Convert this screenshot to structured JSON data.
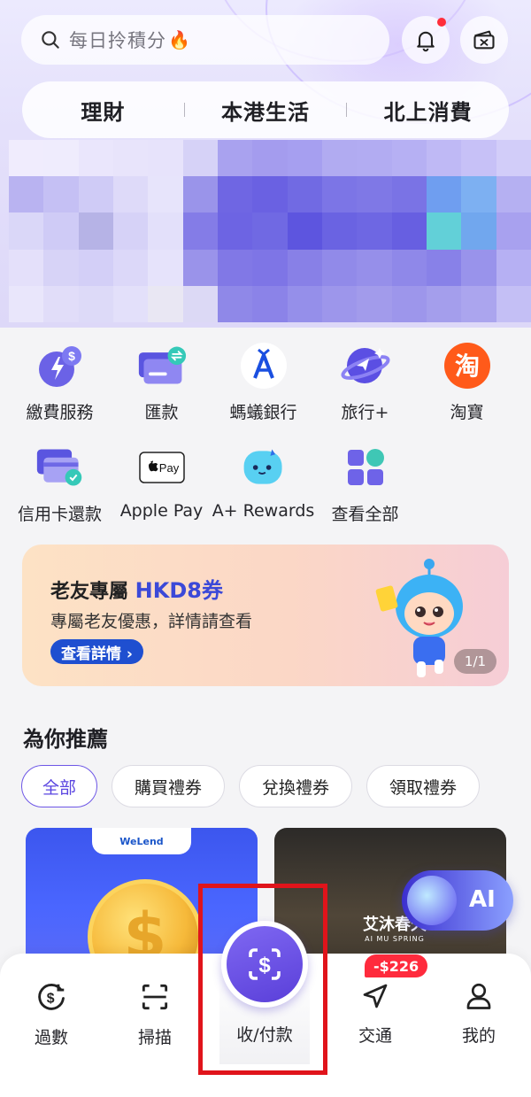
{
  "header": {
    "search_placeholder": "每日拎積分",
    "segments": [
      "理財",
      "本港生活",
      "北上消費"
    ]
  },
  "banner_colors": [
    [
      "#f0ecfd",
      "#efecfd",
      "#eae6fc",
      "#e8e4fb",
      "#e7e3fb",
      "#d6d2f7",
      "#a9a2ef",
      "#a49cee",
      "#a69ff0",
      "#b1abf1",
      "#b2acf2",
      "#b6b0f3",
      "#bfb9f5",
      "#c7c1f7",
      "#d2cdf9"
    ],
    [
      "#b9b3f1",
      "#c5c0f4",
      "#cfcbf6",
      "#dedaf9",
      "#e7e4fb",
      "#9a94ea",
      "#6f66e3",
      "#6a61e2",
      "#716ae3",
      "#7c75e6",
      "#7f78e6",
      "#7a73e5",
      "#6f9ef0",
      "#7db0f2",
      "#b5b0f2"
    ],
    [
      "#dad7f8",
      "#cfcbf6",
      "#b6b3e6",
      "#d6d2f7",
      "#e3e0fa",
      "#847ce7",
      "#6d64e3",
      "#7069e3",
      "#5d55df",
      "#6a63e2",
      "#6e67e3",
      "#675fe1",
      "#62d0d8",
      "#71a7ee",
      "#a8a1ef"
    ],
    [
      "#e4e0fa",
      "#d7d3f7",
      "#d3cff7",
      "#dcd8f9",
      "#e6e3fb",
      "#9a93ea",
      "#8178e6",
      "#7e75e6",
      "#8880e7",
      "#918ae9",
      "#968fea",
      "#8f88e9",
      "#8881e8",
      "#9993eb",
      "#b6b0f3"
    ],
    [
      "#e9e6fb",
      "#e1ddf9",
      "#dddaf8",
      "#e3e0fa",
      "#e9e7f3",
      "#dcd9f5",
      "#8f88e8",
      "#8b83e8",
      "#958fea",
      "#9d96eb",
      "#a29beb",
      "#9d96eb",
      "#a49eec",
      "#aba5ee",
      "#c4bff5"
    ]
  ],
  "shortcuts": [
    {
      "label": "繳費服務",
      "icon": "bill-payment-icon"
    },
    {
      "label": "匯款",
      "icon": "remittance-icon"
    },
    {
      "label": "螞蟻銀行",
      "icon": "ant-bank-icon"
    },
    {
      "label": "旅行+",
      "icon": "travel-icon"
    },
    {
      "label": "淘寶",
      "icon": "taobao-icon"
    },
    {
      "label": "信用卡還款",
      "icon": "credit-card-repay-icon"
    },
    {
      "label": "Apple Pay",
      "icon": "apple-pay-icon"
    },
    {
      "label": "A+ Rewards",
      "icon": "rewards-icon"
    },
    {
      "label": "查看全部",
      "icon": "view-all-icon"
    }
  ],
  "apple_pay_glyph": "Pay",
  "taobao_glyph": "淘",
  "promo": {
    "title_prefix": "老友專屬 ",
    "title_highlight": "HKD8券",
    "subtitle": "專屬老友優惠，詳情請查看",
    "button": "查看詳情 ›",
    "page_indicator": "1/1"
  },
  "recommend": {
    "title": "為你推薦",
    "chips": [
      "全部",
      "購買禮券",
      "兌換禮券",
      "領取禮券"
    ],
    "card1_brand": "WeLend",
    "card1_symbol": "$",
    "card2_brand": "艾沐春天",
    "card2_brand_en": "AI MU SPRING"
  },
  "ai_button": "AI",
  "tabbar": {
    "items": [
      "過數",
      "掃描",
      "收/付款",
      "交通",
      "我的"
    ],
    "transport_badge": "-$226"
  },
  "colors": {
    "accent": "#5a45e0",
    "badge_red": "#ff2b3d",
    "highlight_red": "#e0141b"
  }
}
